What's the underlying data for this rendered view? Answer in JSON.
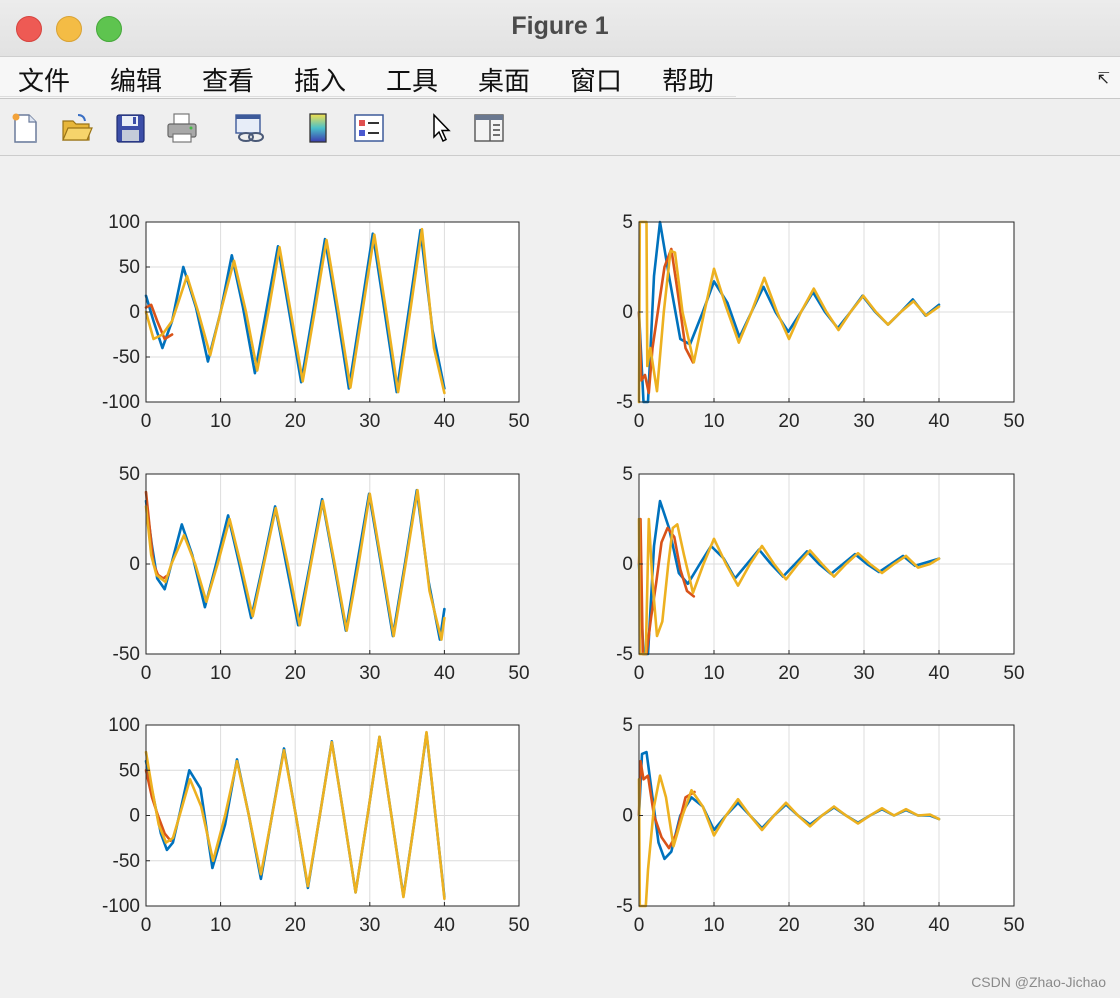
{
  "window": {
    "title": "Figure 1"
  },
  "menu": [
    "文件",
    "编辑",
    "查看",
    "插入",
    "工具",
    "桌面",
    "窗口",
    "帮助"
  ],
  "toolbar": {
    "icons": [
      "new-figure-icon",
      "open-folder-icon",
      "save-disk-icon",
      "print-icon",
      "link-plot-icon",
      "colorbar-icon",
      "legend-icon",
      "pointer-cursor-icon",
      "property-inspector-icon"
    ]
  },
  "watermark": "CSDN @Zhao-Jichao",
  "colors": {
    "blue": "#0072BD",
    "red": "#D95319",
    "yellow": "#EDB120"
  },
  "chart_data": [
    {
      "type": "line",
      "xlim": [
        0,
        50
      ],
      "ylim": [
        -100,
        100
      ],
      "xticks": [
        0,
        10,
        20,
        30,
        40,
        50
      ],
      "yticks": [
        100,
        50,
        0,
        -50,
        -100
      ],
      "grid": true,
      "series": [
        {
          "color": "blue",
          "x": [
            0,
            1,
            2.2,
            3.5,
            5,
            6.7,
            8.3,
            10,
            11.5,
            13,
            14.6,
            16.2,
            17.7,
            19.2,
            20.8,
            22.4,
            24,
            25.6,
            27.2,
            28.8,
            30.4,
            32,
            33.6,
            35.2,
            36.8,
            38.4,
            40
          ],
          "values": [
            18,
            -10,
            -40,
            -10,
            50,
            5,
            -55,
            0,
            63,
            5,
            -68,
            5,
            73,
            0,
            -78,
            0,
            81,
            0,
            -85,
            0,
            87,
            0,
            -89,
            0,
            91,
            -20,
            -85
          ]
        },
        {
          "color": "red",
          "x": [
            0,
            0.7,
            1.5,
            2.5,
            3.5
          ],
          "values": [
            5,
            8,
            -10,
            -30,
            -25
          ]
        },
        {
          "color": "yellow",
          "x": [
            0,
            1,
            2.2,
            3.5,
            5.5,
            7,
            8.6,
            10,
            11.8,
            13.4,
            14.9,
            16.4,
            17.9,
            19.4,
            21,
            22.6,
            24.2,
            25.8,
            27.4,
            29,
            30.6,
            32.2,
            33.8,
            35.4,
            37,
            38.6,
            40
          ],
          "values": [
            0,
            -30,
            -25,
            -10,
            40,
            0,
            -48,
            0,
            57,
            0,
            -65,
            0,
            72,
            0,
            -77,
            0,
            80,
            0,
            -84,
            0,
            86,
            0,
            -89,
            0,
            92,
            -40,
            -90
          ]
        }
      ]
    },
    {
      "type": "line",
      "xlim": [
        0,
        50
      ],
      "ylim": [
        -5,
        5
      ],
      "xticks": [
        0,
        10,
        20,
        30,
        40,
        50
      ],
      "yticks": [
        5,
        0,
        -5
      ],
      "grid": true,
      "series": [
        {
          "color": "blue",
          "x": [
            0,
            0.6,
            1.2,
            2,
            2.8,
            4,
            5.5,
            6.8,
            8.5,
            10,
            11.8,
            13.4,
            15,
            16.6,
            18.2,
            19.9,
            21.6,
            23.2,
            24.8,
            26.5,
            28.2,
            29.8,
            31.5,
            33.2,
            34.9,
            36.5,
            38.2,
            40
          ],
          "values": [
            0,
            -5,
            -5,
            2,
            5,
            2,
            -1.5,
            -1.8,
            0,
            1.7,
            0.5,
            -1.4,
            0,
            1.4,
            0,
            -1.1,
            0,
            1.1,
            0,
            -0.9,
            0,
            0.9,
            0,
            -0.7,
            0,
            0.7,
            -0.2,
            0.4
          ]
        },
        {
          "color": "red",
          "x": [
            0,
            0.3,
            0.8,
            1.3,
            1.8,
            2.5,
            3.4,
            4.3,
            5.2,
            6.2,
            7.2
          ],
          "values": [
            0,
            -3.8,
            -3.5,
            -4.5,
            -2,
            0,
            2.5,
            3.5,
            1,
            -2,
            -2.8
          ]
        },
        {
          "color": "yellow",
          "x": [
            0,
            0.1,
            0.2,
            1,
            1.1,
            1.5,
            2.4,
            3.3,
            4.2,
            4.8,
            5.8,
            7.3,
            8.7,
            10,
            11.6,
            13.3,
            15,
            16.7,
            18.4,
            20,
            21.6,
            23.3,
            25,
            26.6,
            28.2,
            29.9,
            31.6,
            33.2,
            34.9,
            36.6,
            38.3,
            40
          ],
          "values": [
            -5,
            5,
            5,
            5,
            -3,
            -2,
            -4.4,
            0,
            3.4,
            3.3,
            0,
            -2.8,
            0,
            2.4,
            0.3,
            -1.7,
            0,
            1.9,
            0,
            -1.5,
            0,
            1.3,
            0,
            -1,
            0,
            0.9,
            0,
            -0.7,
            0,
            0.6,
            -0.2,
            0.3
          ]
        }
      ]
    },
    {
      "type": "line",
      "xlim": [
        0,
        50
      ],
      "ylim": [
        -50,
        50
      ],
      "xticks": [
        0,
        10,
        20,
        30,
        40,
        50
      ],
      "yticks": [
        50,
        0,
        -50
      ],
      "grid": true,
      "series": [
        {
          "color": "blue",
          "x": [
            0,
            0.8,
            1.5,
            2.5,
            3.4,
            4.8,
            6.2,
            7.9,
            9.4,
            11,
            12.5,
            14.1,
            15.7,
            17.3,
            18.8,
            20.4,
            22,
            23.6,
            25.2,
            26.8,
            28.3,
            29.9,
            31.5,
            33.1,
            34.7,
            36.3,
            37.9,
            39.4,
            40
          ],
          "values": [
            35,
            10,
            -8,
            -14,
            0,
            22,
            5,
            -24,
            0,
            27,
            0,
            -30,
            0,
            32,
            0,
            -34,
            0,
            36,
            0,
            -37,
            0,
            39,
            0,
            -40,
            0,
            41,
            -10,
            -42,
            -25
          ]
        },
        {
          "color": "red",
          "x": [
            0,
            0.5,
            1,
            1.6,
            2.3,
            3
          ],
          "values": [
            40,
            20,
            0,
            -6,
            -8,
            -6
          ]
        },
        {
          "color": "yellow",
          "x": [
            0,
            0.7,
            1.4,
            2.6,
            3.4,
            5.1,
            6.6,
            8.1,
            9.6,
            11.2,
            12.7,
            14.3,
            15.8,
            17.4,
            19,
            20.6,
            22.1,
            23.7,
            25.3,
            26.9,
            28.5,
            30,
            31.6,
            33.2,
            34.8,
            36.4,
            38,
            39.6,
            40
          ],
          "values": [
            32,
            5,
            -6,
            -10,
            0,
            16,
            0,
            -21,
            0,
            25,
            0,
            -29,
            0,
            31,
            0,
            -34,
            0,
            35,
            0,
            -37,
            0,
            39,
            0,
            -40,
            0,
            41,
            -15,
            -42,
            -30
          ]
        }
      ]
    },
    {
      "type": "line",
      "xlim": [
        0,
        50
      ],
      "ylim": [
        -5,
        5
      ],
      "xticks": [
        0,
        10,
        20,
        30,
        40,
        50
      ],
      "yticks": [
        5,
        0,
        -5
      ],
      "grid": true,
      "series": [
        {
          "color": "blue",
          "x": [
            0,
            0.6,
            1.2,
            2,
            2.8,
            4,
            5.3,
            6.5,
            8.1,
            9.6,
            11.3,
            12.8,
            14.4,
            16,
            17.6,
            19.2,
            20.8,
            22.4,
            24,
            25.6,
            27.2,
            28.8,
            30.4,
            32,
            33.6,
            35.2,
            36.8,
            38.4,
            40
          ],
          "values": [
            0,
            -5,
            -5,
            1,
            3.5,
            2,
            -0.5,
            -1.1,
            0,
            1,
            0.3,
            -0.8,
            0,
            0.8,
            0,
            -0.7,
            0,
            0.7,
            0,
            -0.55,
            0,
            0.55,
            0,
            -0.45,
            0,
            0.45,
            -0.1,
            0.1,
            0.3
          ]
        },
        {
          "color": "red",
          "x": [
            0,
            0.2,
            0.5,
            1,
            1.6,
            2.3,
            3,
            3.8,
            4.7,
            5.5,
            6.4,
            7.3
          ],
          "values": [
            0,
            2.5,
            -5,
            -5,
            -3,
            -1,
            1.2,
            2,
            1.5,
            -0.3,
            -1.5,
            -1.8
          ]
        },
        {
          "color": "yellow",
          "x": [
            0,
            0.1,
            0.4,
            0.9,
            1.3,
            1.8,
            2.4,
            3.1,
            3.9,
            4.5,
            5.1,
            6,
            7.2,
            8.6,
            10,
            11.6,
            13.2,
            14.8,
            16.4,
            18,
            19.6,
            21.2,
            22.8,
            24.4,
            26,
            27.6,
            29.2,
            30.8,
            32.4,
            34,
            35.6,
            37.2,
            38.8,
            40
          ],
          "values": [
            2.5,
            -5,
            -5,
            -5,
            2.5,
            -1,
            -4,
            -3.2,
            0,
            2,
            2.2,
            0.5,
            -1.6,
            0,
            1.4,
            0,
            -1.2,
            0,
            1,
            0,
            -0.85,
            0,
            0.75,
            0,
            -0.7,
            0,
            0.6,
            0,
            -0.5,
            0,
            0.45,
            -0.2,
            0,
            0.3
          ]
        }
      ]
    },
    {
      "type": "line",
      "xlim": [
        0,
        50
      ],
      "ylim": [
        -100,
        100
      ],
      "xticks": [
        0,
        10,
        20,
        30,
        40,
        50
      ],
      "yticks": [
        100,
        50,
        0,
        -50,
        -100
      ],
      "grid": true,
      "series": [
        {
          "color": "blue",
          "x": [
            0,
            1,
            2,
            2.8,
            3.6,
            4.6,
            5.8,
            7.3,
            8.9,
            10.6,
            12.2,
            13.8,
            15.4,
            17,
            18.5,
            20.1,
            21.7,
            23.3,
            24.9,
            26.5,
            28.1,
            29.7,
            31.3,
            32.9,
            34.5,
            36.1,
            37.6,
            39.2,
            40
          ],
          "values": [
            60,
            20,
            -20,
            -38,
            -30,
            5,
            50,
            30,
            -58,
            -10,
            62,
            0,
            -70,
            5,
            74,
            0,
            -80,
            0,
            82,
            0,
            -85,
            0,
            87,
            0,
            -89,
            0,
            91,
            -30,
            -90
          ]
        },
        {
          "color": "red",
          "x": [
            0,
            0.8,
            1.6,
            2.5,
            3.3
          ],
          "values": [
            50,
            20,
            0,
            -20,
            -28
          ]
        },
        {
          "color": "yellow",
          "x": [
            0,
            0.8,
            1.7,
            2.7,
            3.6,
            4.5,
            5.9,
            7.4,
            9,
            10.6,
            12.2,
            13.8,
            15.4,
            16.9,
            18.5,
            20.1,
            21.7,
            23.3,
            24.9,
            26.5,
            28.1,
            29.7,
            31.3,
            32.9,
            34.5,
            36.1,
            37.6,
            39.2,
            40
          ],
          "values": [
            70,
            30,
            -10,
            -30,
            -25,
            0,
            40,
            10,
            -50,
            0,
            60,
            0,
            -65,
            0,
            72,
            0,
            -78,
            0,
            81,
            0,
            -85,
            0,
            87,
            0,
            -90,
            0,
            92,
            -30,
            -92
          ]
        }
      ]
    },
    {
      "type": "line",
      "xlim": [
        0,
        50
      ],
      "ylim": [
        -5,
        5
      ],
      "xticks": [
        0,
        10,
        20,
        30,
        40,
        50
      ],
      "yticks": [
        5,
        0,
        -5
      ],
      "grid": true,
      "series": [
        {
          "color": "blue",
          "x": [
            0,
            0.4,
            1,
            1.8,
            2.6,
            3.4,
            4.3,
            5.5,
            7,
            8.5,
            10,
            11.6,
            13.2,
            14.8,
            16.4,
            18,
            19.6,
            21.2,
            22.8,
            24.4,
            26,
            27.6,
            29.2,
            30.8,
            32.4,
            34,
            35.6,
            37.2,
            38.8,
            40
          ],
          "values": [
            0,
            3.4,
            3.5,
            1,
            -1.5,
            -2.4,
            -2,
            0,
            1,
            0.5,
            -0.8,
            0,
            0.7,
            0,
            -0.7,
            0,
            0.6,
            0,
            -0.5,
            0,
            0.45,
            0,
            -0.4,
            0,
            0.35,
            0,
            0.3,
            0,
            0,
            -0.2
          ]
        },
        {
          "color": "red",
          "x": [
            0,
            0.2,
            0.6,
            1.2,
            2,
            3,
            4,
            5,
            6.2,
            7.4
          ],
          "values": [
            0,
            3,
            2,
            2.2,
            0,
            -1.2,
            -1.8,
            -1,
            1,
            1.3
          ]
        },
        {
          "color": "yellow",
          "x": [
            0,
            0.1,
            0.9,
            1.2,
            2,
            2.8,
            3.6,
            4.6,
            5.8,
            7,
            8.5,
            10,
            11.6,
            13.2,
            14.8,
            16.4,
            18,
            19.6,
            21.2,
            22.8,
            24.4,
            26,
            27.6,
            29.2,
            30.8,
            32.4,
            34,
            35.6,
            37.2,
            38.8,
            40
          ],
          "values": [
            2,
            -5,
            -5,
            -3,
            0.5,
            2.2,
            1,
            -1.7,
            0,
            1.4,
            0.5,
            -1.1,
            0,
            0.9,
            0,
            -0.8,
            0,
            0.7,
            0,
            -0.6,
            0,
            0.5,
            0,
            -0.45,
            0,
            0.4,
            0,
            0.35,
            0,
            0.05,
            -0.2
          ]
        }
      ]
    }
  ]
}
